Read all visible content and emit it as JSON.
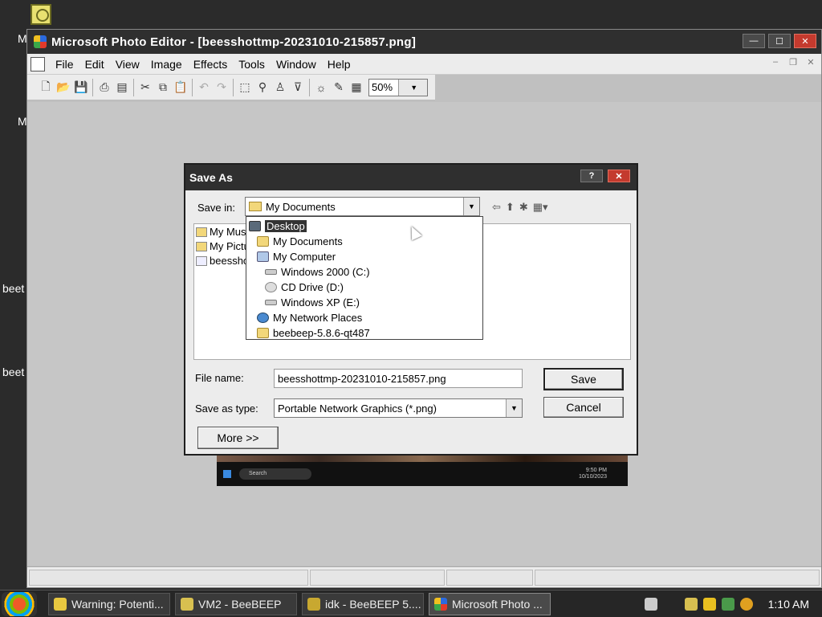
{
  "desktop": {
    "texts": [
      "M",
      "M",
      "beet",
      "beet"
    ]
  },
  "window": {
    "title": "Microsoft Photo Editor - [beesshottmp-20231010-215857.png]",
    "buttons": {
      "minimize": "—",
      "maximize": "☐",
      "close": "✕"
    }
  },
  "menu": {
    "items": [
      "File",
      "Edit",
      "View",
      "Image",
      "Effects",
      "Tools",
      "Window",
      "Help"
    ]
  },
  "toolbar": {
    "zoom": "50%"
  },
  "image_preview": {
    "search_text": "Search",
    "time": "9:50 PM",
    "date": "10/10/2023"
  },
  "dialog": {
    "title": "Save As",
    "help_btn": "?",
    "close_btn": "✕",
    "save_in_label": "Save in:",
    "save_in_value": "My Documents",
    "file_list": [
      "My Music",
      "My Pictures",
      "beesshottmp"
    ],
    "dropdown_items": [
      "Desktop",
      "My Documents",
      "My Computer",
      "Windows 2000 (C:)",
      "CD Drive (D:)",
      "Windows XP (E:)",
      "My Network Places",
      "beebeep-5.8.6-qt487"
    ],
    "file_name_label": "File name:",
    "file_name_value": "beesshottmp-20231010-215857.png",
    "save_type_label": "Save as type:",
    "save_type_value": "Portable Network Graphics (*.png)",
    "save_btn": "Save",
    "cancel_btn": "Cancel",
    "more_btn": "More >>"
  },
  "taskbar": {
    "tasks": [
      "Warning: Potenti...",
      "VM2 - BeeBEEP",
      "idk - BeeBEEP 5....",
      "Microsoft Photo ..."
    ],
    "clock": "1:10 AM"
  }
}
